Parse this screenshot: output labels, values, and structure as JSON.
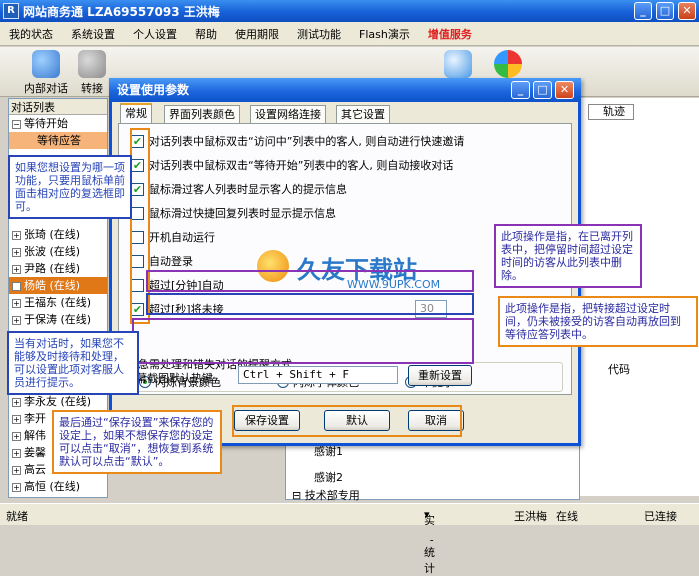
{
  "main_window": {
    "title": "网站商务通  LZA69557093 王洪梅"
  },
  "menu": {
    "items": [
      "我的状态",
      "系统设置",
      "个人设置",
      "帮助",
      "使用期限",
      "测试功能",
      "Flash演示"
    ],
    "vip_item": "增值服务"
  },
  "toolbar": {
    "internal_chat": "内部对话",
    "transfer": "转接"
  },
  "left_panel": {
    "header": "对话列表",
    "waiting_start": "等待开始",
    "waiting_reply": "等待应答",
    "rows": [
      {
        "name": "张琦",
        "status": "(在线)"
      },
      {
        "name": "张波",
        "status": "(在线)"
      },
      {
        "name": "尹路",
        "status": "(在线)"
      },
      {
        "name": "杨皓",
        "status": "(在线)"
      },
      {
        "name": "王福东",
        "status": "(在线)"
      },
      {
        "name": "于保涛",
        "status": "(在线)"
      },
      {
        "name": "李永友",
        "status": "(在线)"
      },
      {
        "name": "李开",
        "status": ""
      },
      {
        "name": "解伟",
        "status": ""
      },
      {
        "name": "姜馨",
        "status": ""
      },
      {
        "name": "高云",
        "status": ""
      },
      {
        "name": "高恒",
        "status": "(在线)"
      }
    ]
  },
  "right_panel": {
    "track_tab": "轨迹",
    "code_tab": "代码"
  },
  "thanks_list": {
    "item1": "感谢1",
    "item2": "感谢2",
    "group": "技术部专用"
  },
  "statusbar": {
    "left": "就绪",
    "stats": "实时统计",
    "user": "王洪梅",
    "user_status": "在线",
    "connection": "已连接"
  },
  "dialog": {
    "title": "设置使用参数",
    "tabs": [
      "常规",
      "界面列表颜色",
      "设置网络连接",
      "其它设置"
    ],
    "options": [
      {
        "label": "对话列表中鼠标双击“访问中”列表中的客人, 则自动进行快速邀请",
        "checked": true
      },
      {
        "label": "对话列表中鼠标双击“等待开始”列表中的客人, 则自动接收对话",
        "checked": true
      },
      {
        "label": "鼠标滑过客人列表时显示客人的提示信息",
        "checked": true
      },
      {
        "label": "鼠标滑过快捷回复列表时显示提示信息",
        "checked": false
      },
      {
        "label": "开机自动运行",
        "checked": false
      },
      {
        "label": "自动登录",
        "checked": false
      },
      {
        "label": "超过[分钟]自动",
        "checked": false
      },
      {
        "label": "超过[秒]将未接",
        "checked": true
      }
    ],
    "timeout_value": "30",
    "group_label": "急需处理和错失对话的提醒方式",
    "radios": [
      {
        "label": "闪烁背景颜色",
        "selected": true
      },
      {
        "label": "闪烁字体颜色",
        "selected": false
      },
      {
        "label": "不提示",
        "selected": false
      }
    ],
    "hotkey_label": "幕截图默认热键",
    "hotkey_value": "Ctrl + Shift + F",
    "reset_button": "重新设置",
    "save_button": "保存设置",
    "default_button": "默认",
    "cancel_button": "取消"
  },
  "callouts": {
    "checkbox_tip": "如果您想设置为哪一项功能，只要用鼠标单前面击相对应的复选框即可。",
    "minutes_tip": "此项操作是指，在已离开列表中，把停留时间超过设定时间的访客从此列表中删除。",
    "seconds_tip": "此项操作是指，把转接超过设定时间，仍未被接受的访客自动再放回到等待应答列表中。",
    "busy_tip": "当有对话时，如果您不能够及时接待和处理，可以设置此项对客服人员进行提示。",
    "save_tip": "最后通过“保存设置”来保存您的设定上，如果不想保存您的设定可以点击“取消”，想恢复到系统默认可以点击“默认”。"
  },
  "watermark": {
    "text": "久友下载站",
    "url": "WWW.9UPK.COM"
  }
}
